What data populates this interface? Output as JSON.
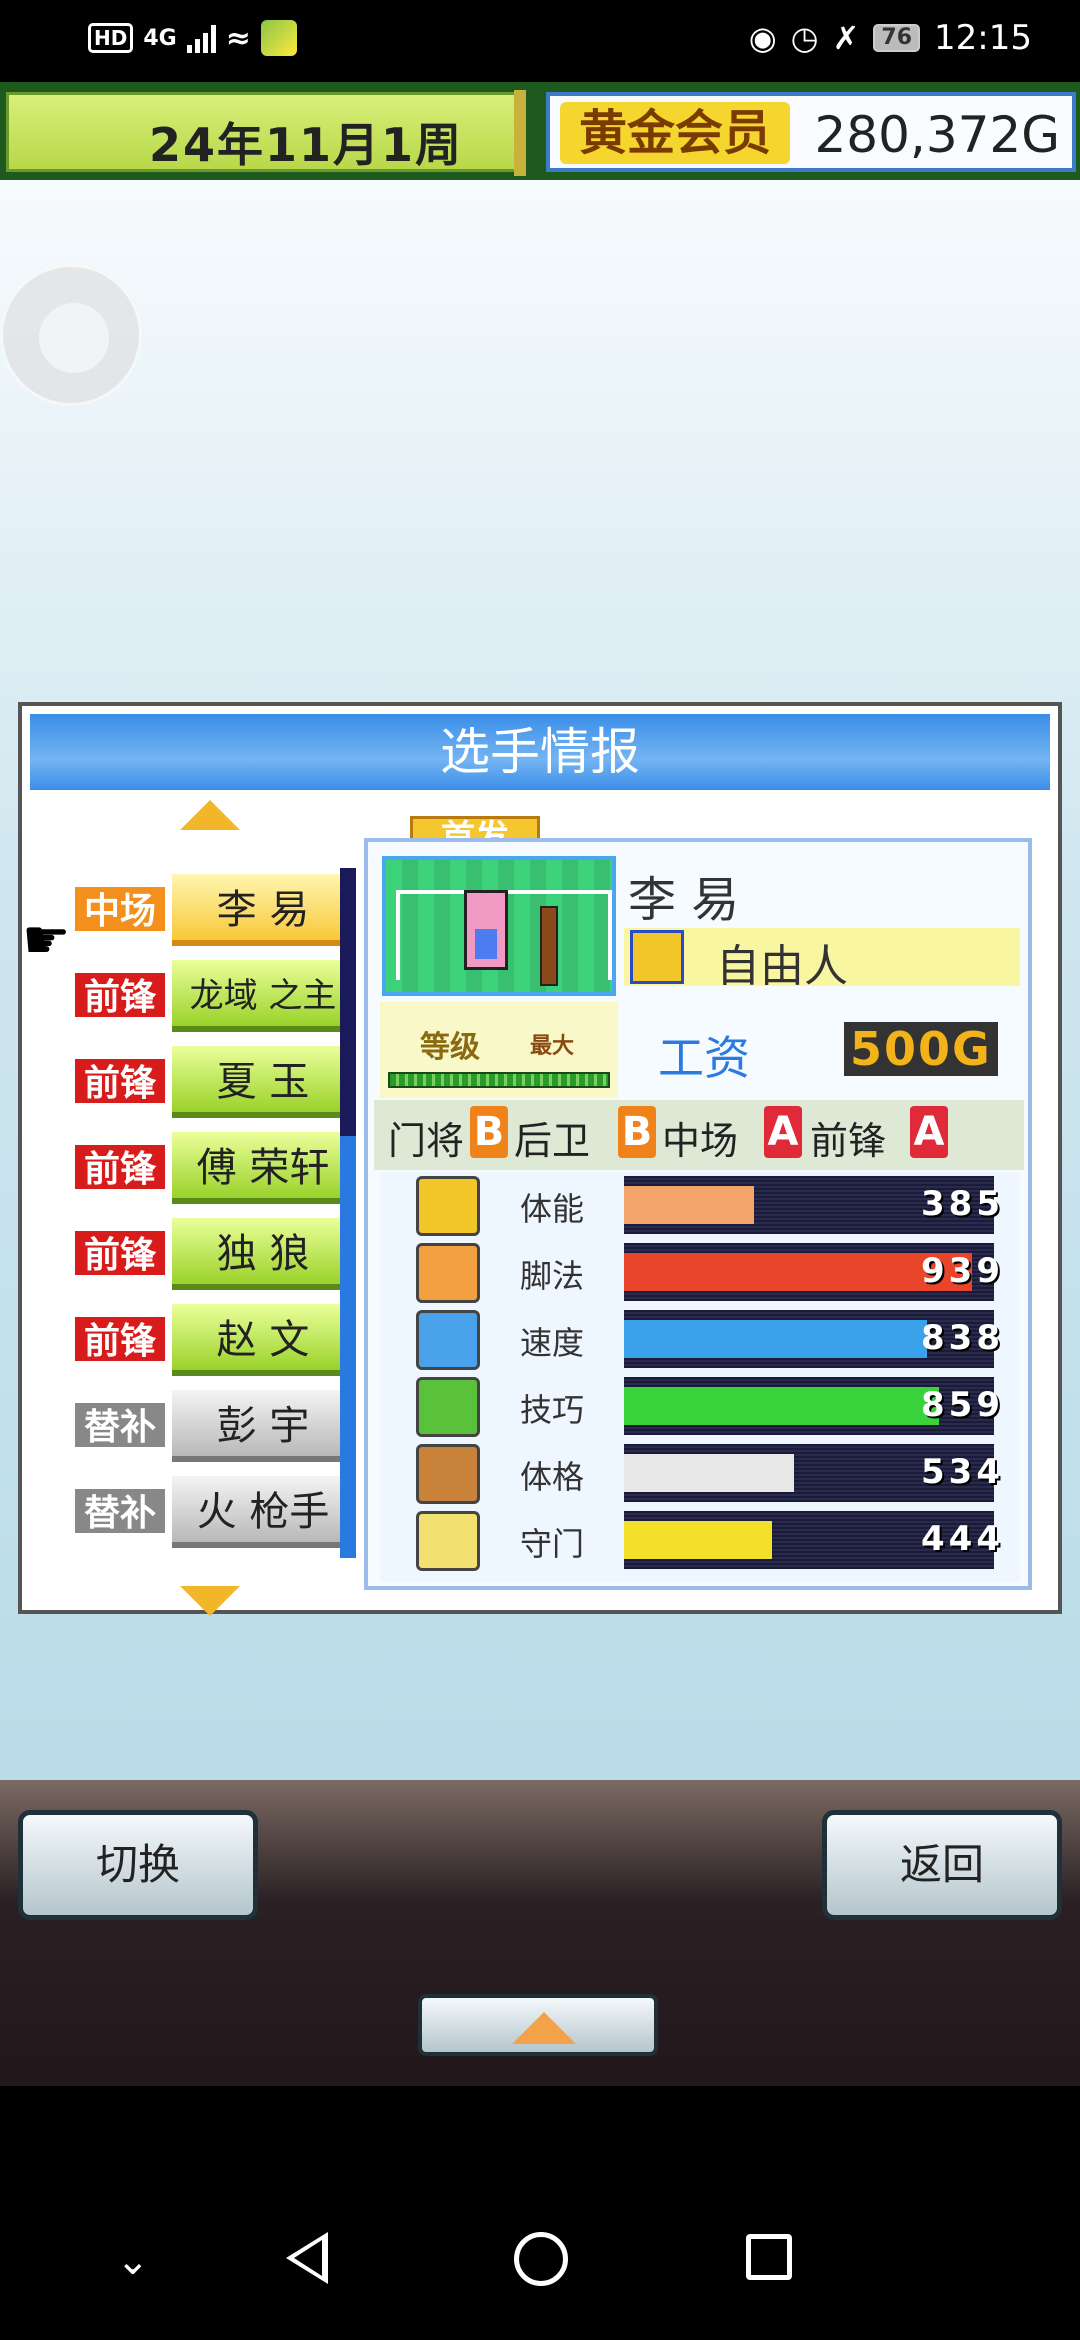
{
  "status_bar": {
    "network": "HD",
    "signal": "4G",
    "battery": "76",
    "time": "12:15"
  },
  "header": {
    "date": "24年11月1周",
    "membership": "黄金会员",
    "money": "280,372G"
  },
  "dialog": {
    "title": "选手情报",
    "players": [
      {
        "position": "中场",
        "name": "李 易",
        "selected": true
      },
      {
        "position": "前锋",
        "name": "龙域 之主"
      },
      {
        "position": "前锋",
        "name": "夏 玉"
      },
      {
        "position": "前锋",
        "name": "傅 荣轩"
      },
      {
        "position": "前锋",
        "name": "独 狼"
      },
      {
        "position": "前锋",
        "name": "赵 文"
      },
      {
        "position": "替补",
        "name": "彭 宇"
      },
      {
        "position": "替补",
        "name": "火 枪手"
      }
    ],
    "detail": {
      "starter_badge": "首发",
      "name": "李 易",
      "status": "自由人",
      "level_label": "等级",
      "level_max": "最大",
      "salary_label": "工资",
      "salary_value": "500G",
      "ranks": [
        {
          "role": "门将",
          "grade": "B"
        },
        {
          "role": "后卫",
          "grade": "B"
        },
        {
          "role": "中场",
          "grade": "A"
        },
        {
          "role": "前锋",
          "grade": "A"
        }
      ],
      "stats": [
        {
          "label": "体能",
          "value": "385",
          "fill": 0.35,
          "color": "#f2a46a"
        },
        {
          "label": "脚法",
          "value": "939",
          "fill": 0.94,
          "color": "#e8452a"
        },
        {
          "label": "速度",
          "value": "838",
          "fill": 0.82,
          "color": "#3aa2ea"
        },
        {
          "label": "技巧",
          "value": "859",
          "fill": 0.85,
          "color": "#3ad23a"
        },
        {
          "label": "体格",
          "value": "534",
          "fill": 0.46,
          "color": "#e8e8e8"
        },
        {
          "label": "守门",
          "value": "444",
          "fill": 0.4,
          "color": "#f2e02a"
        }
      ]
    }
  },
  "controls": {
    "switch_label": "切换",
    "back_label": "返回"
  },
  "icons": {
    "hand": "pointing-hand-icon",
    "up": "arrow-up-icon",
    "down": "arrow-down-icon"
  }
}
